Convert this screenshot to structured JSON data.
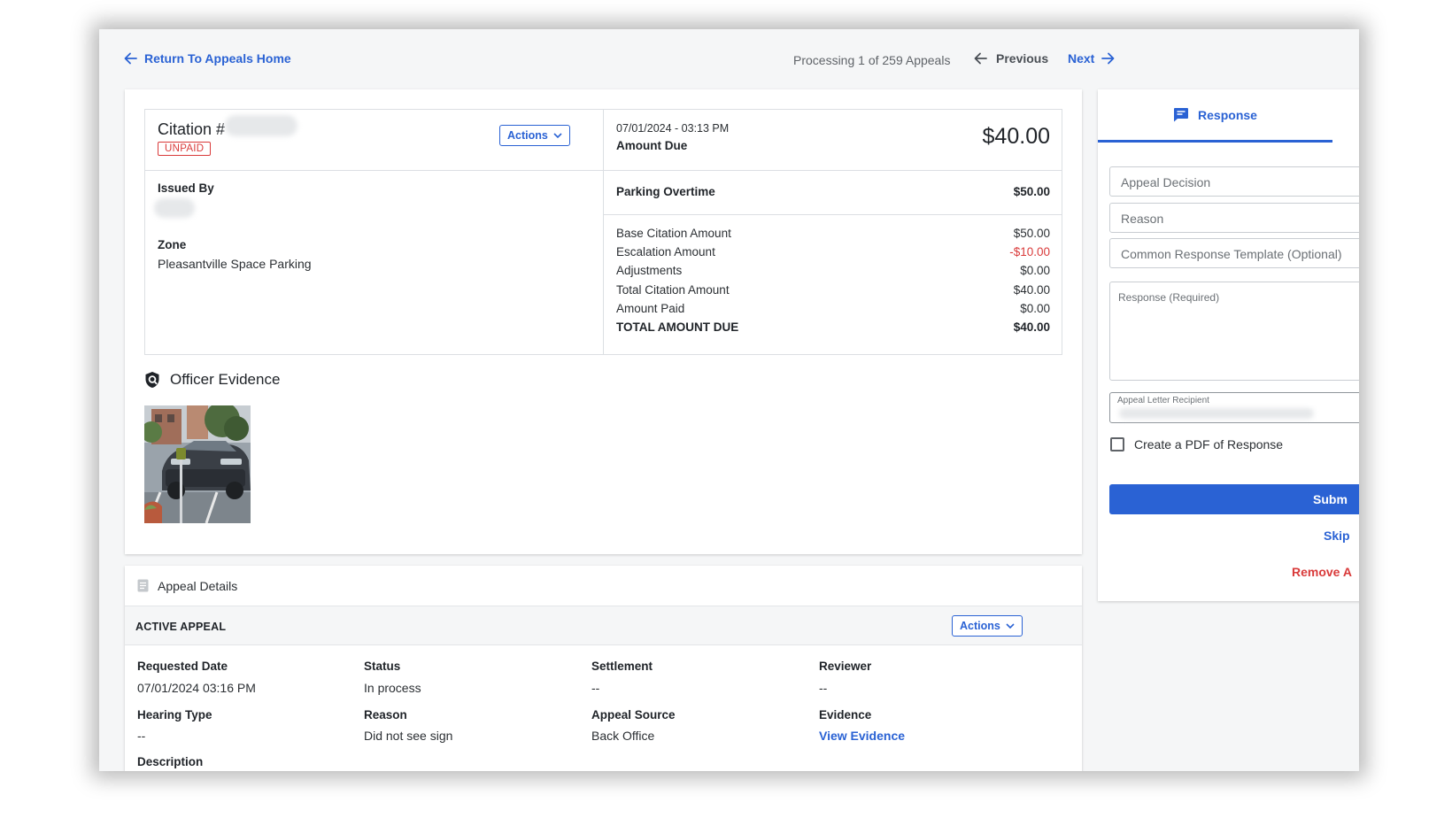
{
  "nav": {
    "back_label": "Return To Appeals Home",
    "processing": "Processing 1 of 259 Appeals",
    "previous": "Previous",
    "next": "Next"
  },
  "citation": {
    "title": "Citation #",
    "status_badge": "UNPAID",
    "actions_label": "Actions",
    "issued_by_label": "Issued By",
    "zone_label": "Zone",
    "zone_value": "Pleasantville Space Parking",
    "datetime": "07/01/2024 - 03:13 PM",
    "amount_due_label": "Amount Due",
    "amount_due": "$40.00",
    "violation": {
      "label": "Parking Overtime",
      "amount": "$50.00"
    },
    "breakdown": [
      {
        "label": "Base Citation Amount",
        "value": "$50.00"
      },
      {
        "label": "Escalation Amount",
        "value": "-$10.00"
      },
      {
        "label": "Adjustments",
        "value": "$0.00"
      },
      {
        "label": "Total Citation Amount",
        "value": "$40.00"
      },
      {
        "label": "Amount Paid",
        "value": "$0.00"
      },
      {
        "label": "TOTAL AMOUNT DUE",
        "value": "$40.00"
      }
    ]
  },
  "evidence": {
    "title": "Officer Evidence"
  },
  "appeal": {
    "section_title": "Appeal Details",
    "active_title": "ACTIVE APPEAL",
    "actions_label": "Actions",
    "fields": {
      "requested_date": {
        "label": "Requested Date",
        "value": "07/01/2024 03:16 PM"
      },
      "status": {
        "label": "Status",
        "value": "In process"
      },
      "settlement": {
        "label": "Settlement",
        "value": "--"
      },
      "reviewer": {
        "label": "Reviewer",
        "value": "--"
      },
      "hearing_type": {
        "label": "Hearing Type",
        "value": "--"
      },
      "reason": {
        "label": "Reason",
        "value": "Did not see sign"
      },
      "appeal_source": {
        "label": "Appeal Source",
        "value": "Back Office"
      },
      "evidence": {
        "label": "Evidence",
        "value": "View Evidence"
      },
      "description": {
        "label": "Description"
      }
    }
  },
  "response": {
    "tab_label": "Response",
    "appeal_decision": "Appeal Decision",
    "reason": "Reason",
    "template": "Common Response Template (Optional)",
    "response_placeholder": "Response (Required)",
    "recipient_label": "Appeal Letter Recipient",
    "pdf_label": "Create a PDF of Response",
    "submit": "Subm",
    "skip": "Skip",
    "remove": "Remove A"
  },
  "colors": {
    "accent": "#2a62d4",
    "danger": "#d93a3a"
  }
}
